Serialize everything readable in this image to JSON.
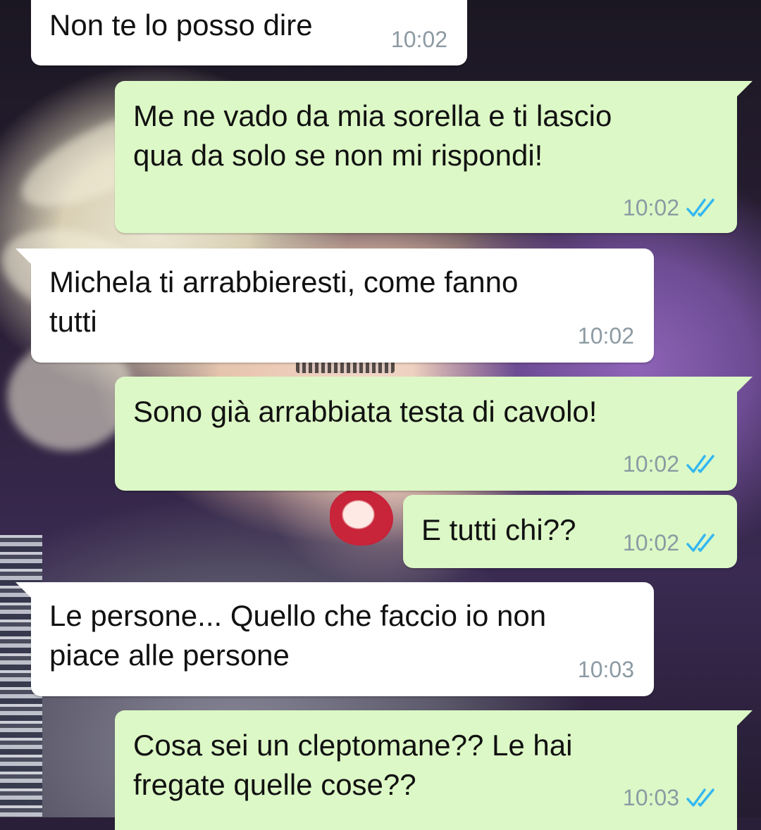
{
  "wallpaper": {
    "description_icon": "photo-wallpaper"
  },
  "colors": {
    "incoming_bubble": "#ffffff",
    "outgoing_bubble": "#dcf8c6",
    "timestamp": "#8c9aa3",
    "read_ticks": "#34b7f1"
  },
  "messages": [
    {
      "direction": "in",
      "text": "Non te lo posso dire",
      "time": "10:02"
    },
    {
      "direction": "out",
      "text": "Me ne vado da mia sorella e ti lascio\nqua da solo se non mi rispondi!",
      "time": "10:02",
      "status": "read"
    },
    {
      "direction": "in",
      "text": "Michela ti arrabbieresti, come fanno\ntutti",
      "time": "10:02"
    },
    {
      "direction": "out",
      "text": "Sono già arrabbiata testa di cavolo!",
      "time": "10:02",
      "status": "read"
    },
    {
      "direction": "out",
      "text": "E tutti chi??",
      "time": "10:02",
      "status": "read"
    },
    {
      "direction": "in",
      "text": "Le persone... Quello che faccio io non\npiace alle persone",
      "time": "10:03"
    },
    {
      "direction": "out",
      "text": "Cosa sei un cleptomane?? Le hai\nfregate quelle cose??",
      "time": "10:03",
      "status": "read"
    }
  ]
}
